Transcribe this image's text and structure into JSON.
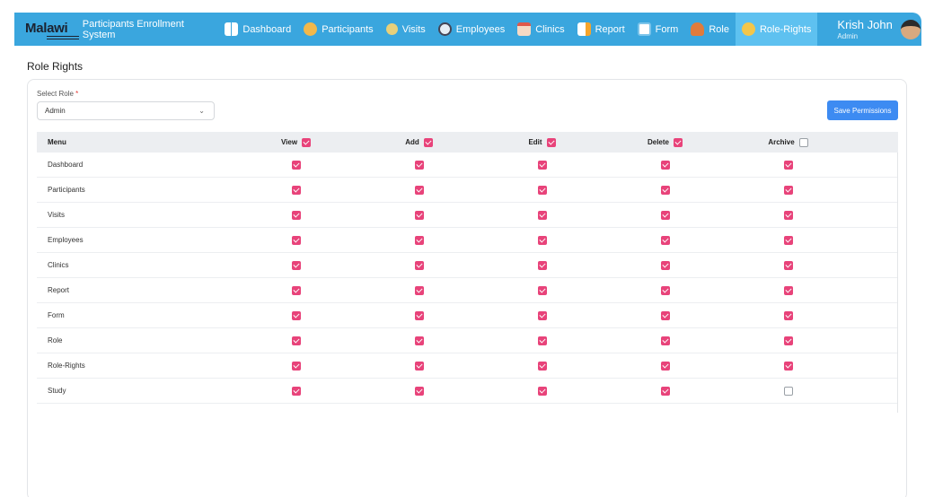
{
  "app": {
    "logo": "Malawi",
    "title": "Participants Enrollment System"
  },
  "nav": [
    {
      "label": "Dashboard",
      "icon": "dashboard-icon"
    },
    {
      "label": "Participants",
      "icon": "participants-icon"
    },
    {
      "label": "Visits",
      "icon": "visits-icon"
    },
    {
      "label": "Employees",
      "icon": "employees-icon"
    },
    {
      "label": "Clinics",
      "icon": "clinics-icon"
    },
    {
      "label": "Report",
      "icon": "report-icon"
    },
    {
      "label": "Form",
      "icon": "form-icon"
    },
    {
      "label": "Role",
      "icon": "role-icon"
    },
    {
      "label": "Role-Rights",
      "icon": "role-rights-icon",
      "active": true
    }
  ],
  "user": {
    "name": "Krish John",
    "role": "Admin"
  },
  "page": {
    "heading": "Role Rights"
  },
  "form": {
    "select_label": "Select Role",
    "required_mark": "*",
    "selected_role": "Admin",
    "chevron": "⌄",
    "save_label": "Save Permissions"
  },
  "table": {
    "columns": {
      "menu": "Menu",
      "view": "View",
      "add": "Add",
      "edit": "Edit",
      "delete": "Delete",
      "archive": "Archive"
    },
    "header_checks": {
      "view": true,
      "add": true,
      "edit": true,
      "delete": true,
      "archive": false
    },
    "rows": [
      {
        "menu": "Dashboard",
        "view": true,
        "add": true,
        "edit": true,
        "delete": true,
        "archive": true
      },
      {
        "menu": "Participants",
        "view": true,
        "add": true,
        "edit": true,
        "delete": true,
        "archive": true
      },
      {
        "menu": "Visits",
        "view": true,
        "add": true,
        "edit": true,
        "delete": true,
        "archive": true
      },
      {
        "menu": "Employees",
        "view": true,
        "add": true,
        "edit": true,
        "delete": true,
        "archive": true
      },
      {
        "menu": "Clinics",
        "view": true,
        "add": true,
        "edit": true,
        "delete": true,
        "archive": true
      },
      {
        "menu": "Report",
        "view": true,
        "add": true,
        "edit": true,
        "delete": true,
        "archive": true
      },
      {
        "menu": "Form",
        "view": true,
        "add": true,
        "edit": true,
        "delete": true,
        "archive": true
      },
      {
        "menu": "Role",
        "view": true,
        "add": true,
        "edit": true,
        "delete": true,
        "archive": true
      },
      {
        "menu": "Role-Rights",
        "view": true,
        "add": true,
        "edit": true,
        "delete": true,
        "archive": true
      },
      {
        "menu": "Study",
        "view": true,
        "add": true,
        "edit": true,
        "delete": true,
        "archive": false
      }
    ]
  },
  "colors": {
    "nav_bg": "#3aa6de",
    "nav_active": "#5ec1f0",
    "checkbox_on": "#e8437a",
    "button": "#3d8bf2"
  }
}
